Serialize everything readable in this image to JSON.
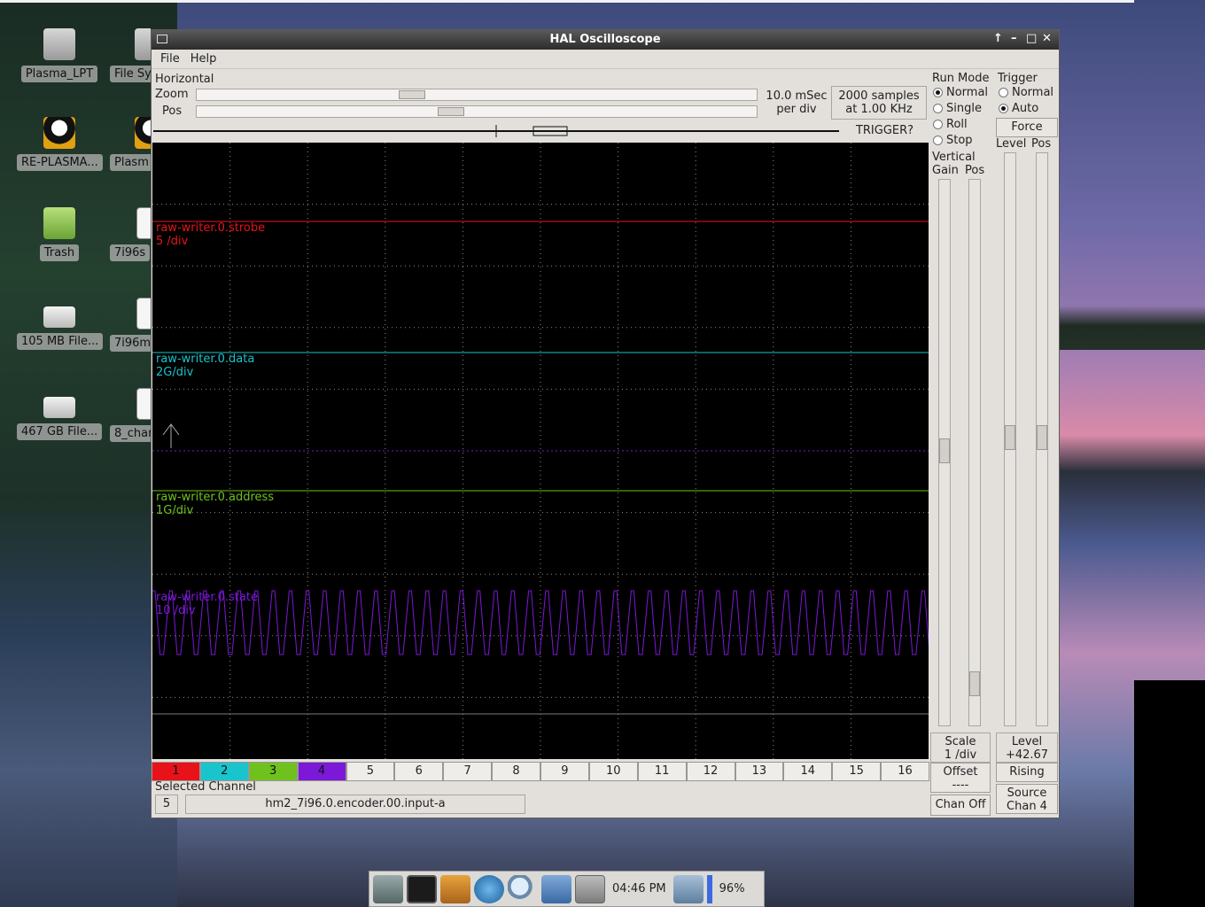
{
  "desktop": {
    "icons": [
      {
        "label": "Plasma_LPT"
      },
      {
        "label": "File Sy"
      },
      {
        "label": "RE-PLASMA..."
      },
      {
        "label": "Plasm"
      },
      {
        "label": "Trash"
      },
      {
        "label": "7i96s"
      },
      {
        "label": "105 MB File..."
      },
      {
        "label": "7i96m"
      },
      {
        "label": "467 GB File..."
      },
      {
        "label": "8_char"
      }
    ]
  },
  "window": {
    "title": "HAL Oscilloscope",
    "controls": [
      "↑",
      "–",
      "□",
      "✕"
    ],
    "menu": [
      "File",
      "Help"
    ]
  },
  "horizontal": {
    "label": "Horizontal",
    "zoom_label": "Zoom",
    "pos_label": "Pos",
    "zoom_value": 0.36,
    "pos_value": 0.43,
    "time_div_line1": "10.0 mSec",
    "time_div_line2": "per div",
    "samples_line1": "2000 samples",
    "samples_line2": "at 1.00 KHz",
    "trigger_status": "TRIGGER?"
  },
  "run_mode": {
    "label": "Run Mode",
    "options": [
      "Normal",
      "Single",
      "Roll",
      "Stop"
    ],
    "selected": "Normal"
  },
  "trigger": {
    "label": "Trigger",
    "options": [
      "Normal",
      "Auto"
    ],
    "selected": "Auto",
    "force_label": "Force",
    "level_col": "Level",
    "pos_col": "Pos",
    "level_line1": "Level",
    "level_line2": "+42.67",
    "edge_label": "Rising",
    "source_line1": "Source",
    "source_line2": "Chan  4"
  },
  "vertical": {
    "label": "Vertical",
    "gain_col": "Gain",
    "pos_col": "Pos",
    "scale_line1": "Scale",
    "scale_line2": "1 /div",
    "offset_line1": "Offset",
    "offset_line2": "----",
    "chan_off_label": "Chan Off"
  },
  "traces": [
    {
      "name": "raw-writer.0.strobe",
      "scale": "5 /div",
      "color": "#e8131a"
    },
    {
      "name": "raw-writer.0.data",
      "scale": "2G/div",
      "color": "#19c4cc"
    },
    {
      "name": "raw-writer.0.address",
      "scale": "1G/div",
      "color": "#6fc21d"
    },
    {
      "name": "raw-writer.0.state",
      "scale": "10 /div",
      "color": "#7c18d8"
    }
  ],
  "channels": [
    {
      "label": "1",
      "color": "#e8131a"
    },
    {
      "label": "2",
      "color": "#19c4cc"
    },
    {
      "label": "3",
      "color": "#6fc21d"
    },
    {
      "label": "4",
      "color": "#7c18d8"
    },
    {
      "label": "5"
    },
    {
      "label": "6"
    },
    {
      "label": "7"
    },
    {
      "label": "8"
    },
    {
      "label": "9"
    },
    {
      "label": "10"
    },
    {
      "label": "11"
    },
    {
      "label": "12"
    },
    {
      "label": "13"
    },
    {
      "label": "14"
    },
    {
      "label": "15"
    },
    {
      "label": "16"
    }
  ],
  "selected_channel": {
    "label": "Selected Channel",
    "number": "5",
    "pin": "hm2_7i96.0.encoder.00.input-a"
  },
  "taskbar": {
    "time": "04:46 PM",
    "battery": "96%"
  }
}
